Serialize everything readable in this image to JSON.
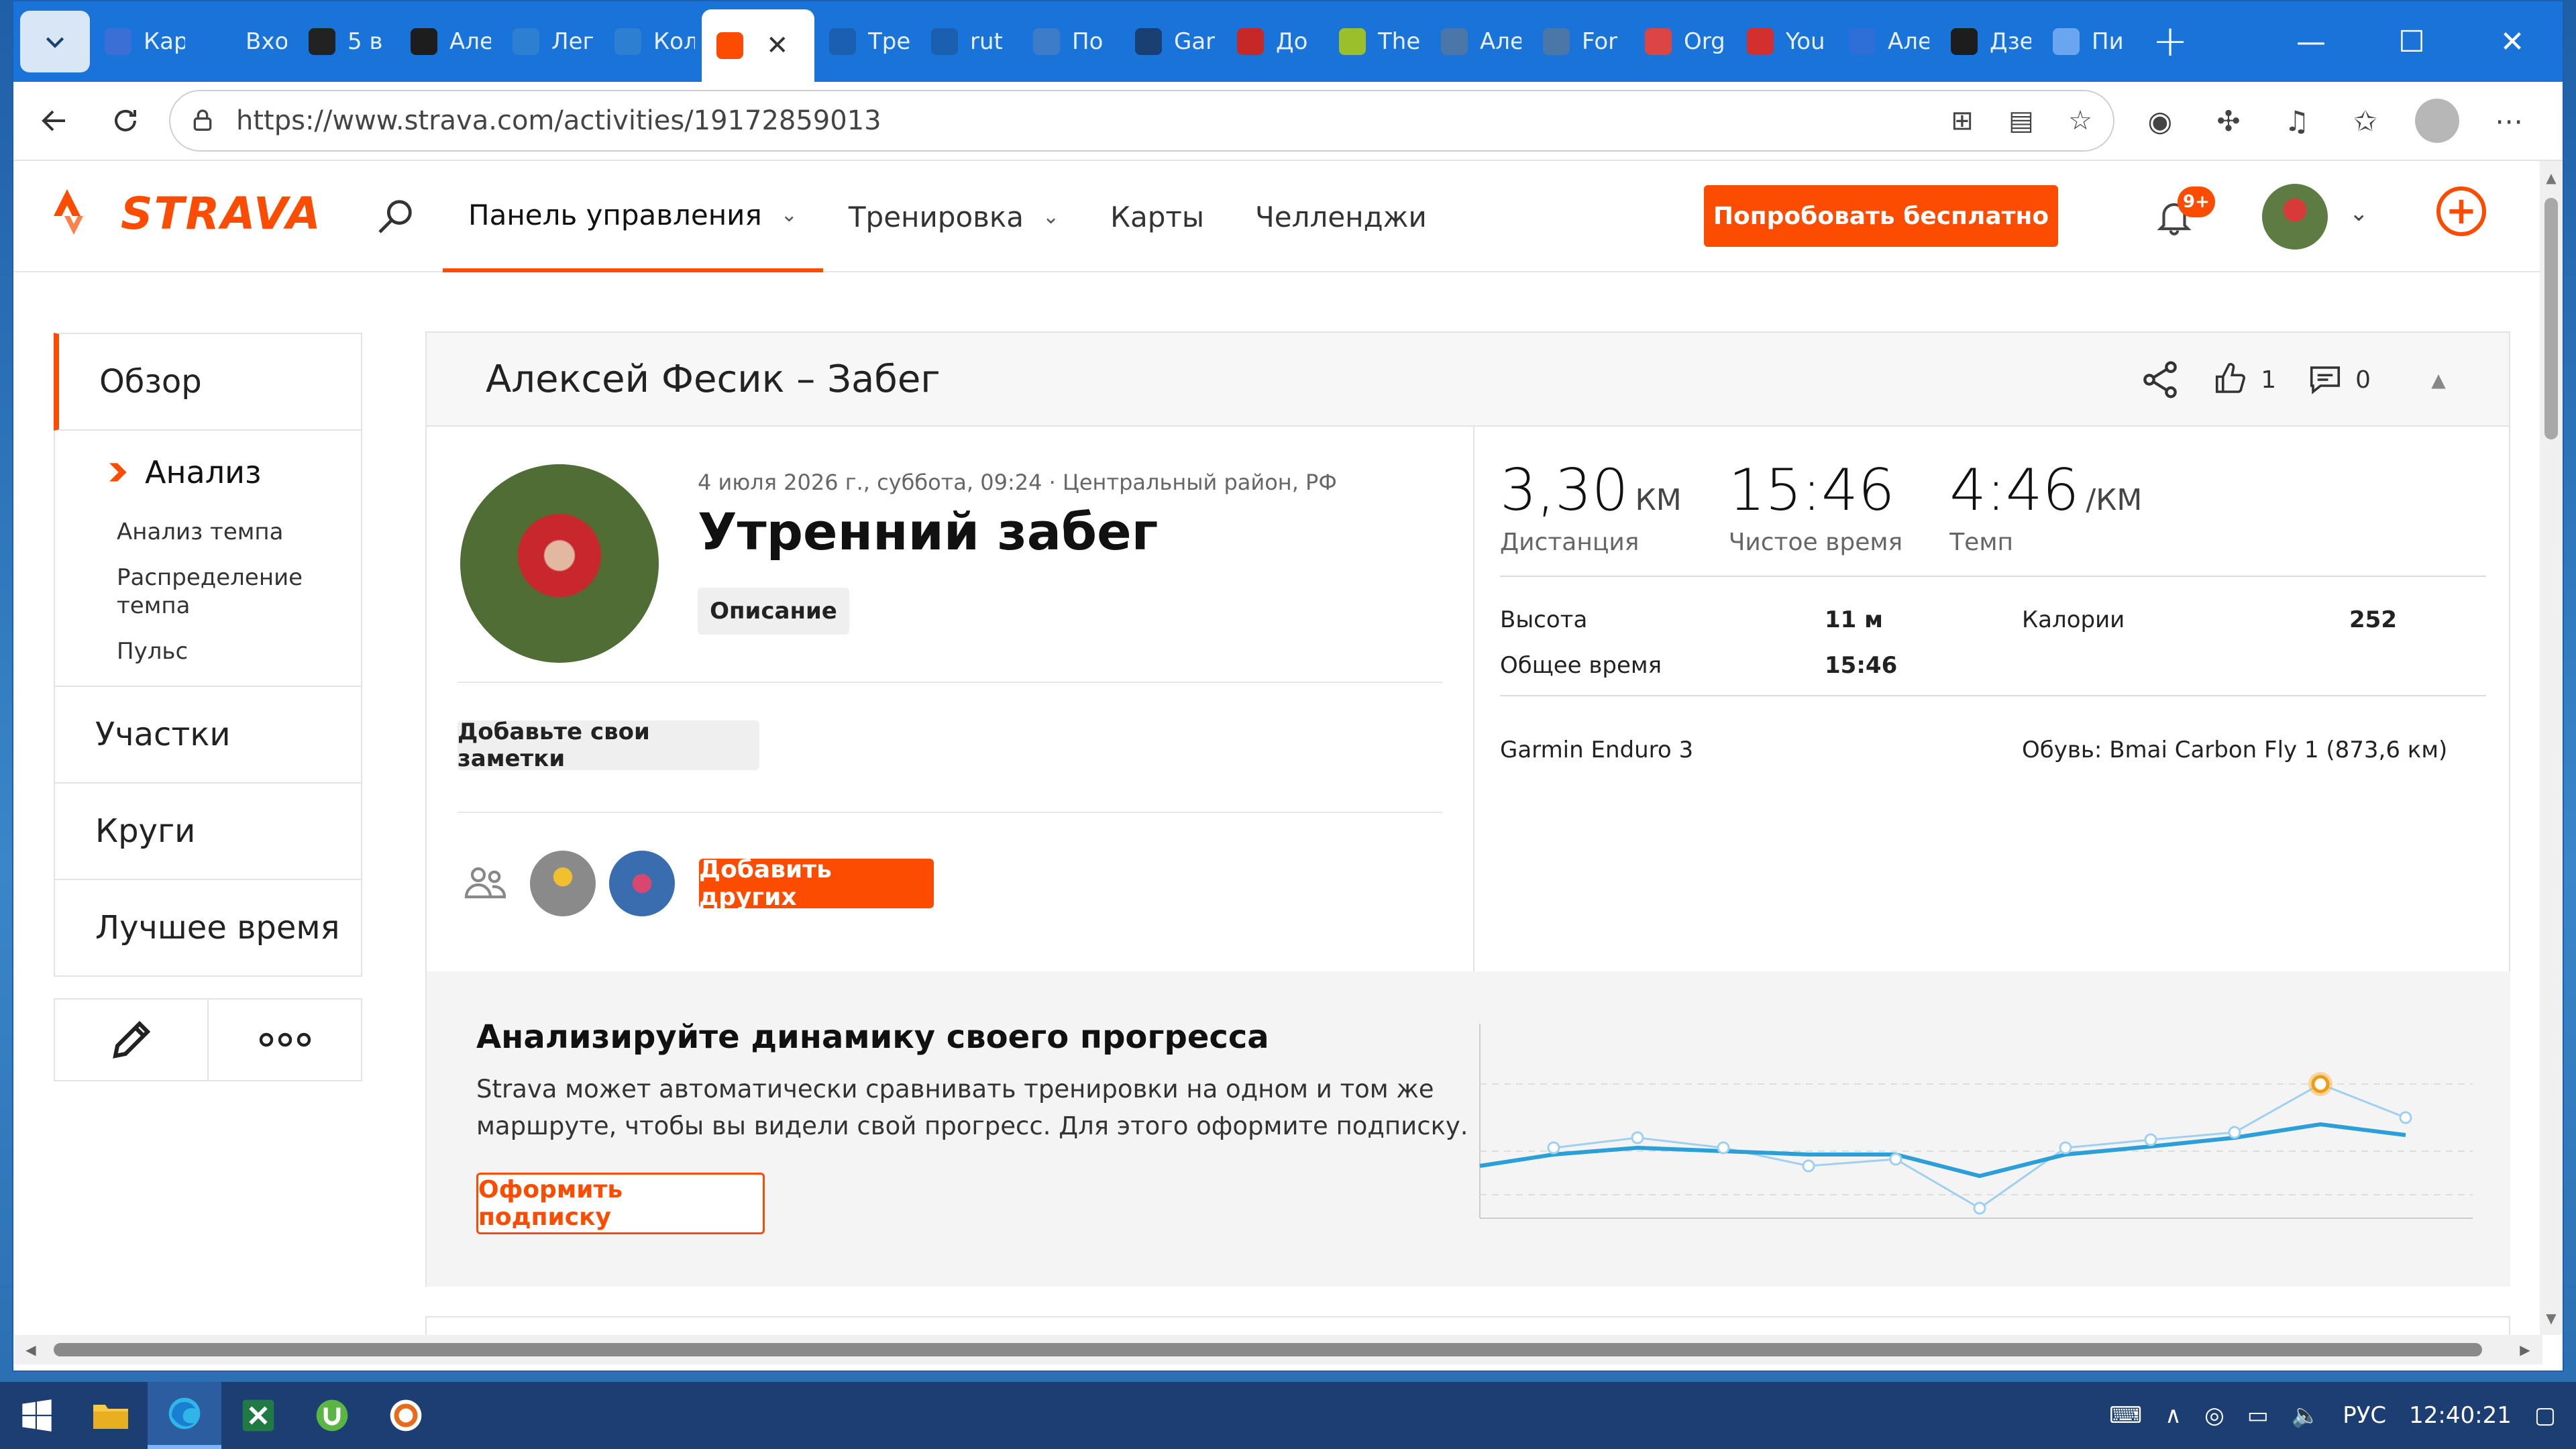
{
  "browser": {
    "tabs": [
      {
        "label": "Кар",
        "icon": "map-pin-icon",
        "color": "#3b6fd6"
      },
      {
        "label": "Вхо",
        "icon": "mail-icon",
        "color": "#1a73d9"
      },
      {
        "label": "5 в",
        "icon": "b-icon",
        "color": "#222222"
      },
      {
        "label": "Але",
        "icon": "runner-icon",
        "color": "#1d1d1d"
      },
      {
        "label": "Лег",
        "icon": "sb-icon",
        "color": "#2d7fd1"
      },
      {
        "label": "Кол",
        "icon": "sb-icon",
        "color": "#2d7fd1"
      },
      {
        "label": "",
        "icon": "strava-icon",
        "color": "#fc4c02",
        "active": true
      },
      {
        "label": "Тре",
        "icon": "drop-icon",
        "color": "#1a5fb0"
      },
      {
        "label": "rut",
        "icon": "lock-icon",
        "color": "#1a5fb0"
      },
      {
        "label": "По",
        "icon": "umbrella-icon",
        "color": "#3d7cc9"
      },
      {
        "label": "Gar",
        "icon": "garmin-icon",
        "color": "#1a3f73"
      },
      {
        "label": "До",
        "icon": "flag-icon",
        "color": "#c62828"
      },
      {
        "label": "The",
        "icon": "circle-icon",
        "color": "#9bbf2a"
      },
      {
        "label": "Але",
        "icon": "vk-icon",
        "color": "#4a76a8"
      },
      {
        "label": "For",
        "icon": "vk-icon",
        "color": "#4a76a8"
      },
      {
        "label": "Org",
        "icon": "check-icon",
        "color": "#d44"
      },
      {
        "label": "You",
        "icon": "youtube-icon",
        "color": "#d32f2f"
      },
      {
        "label": "Але",
        "icon": "r-icon",
        "color": "#2d6fd6"
      },
      {
        "label": "Дзе",
        "icon": "star-icon",
        "color": "#1d1d1d"
      },
      {
        "label": "Пи",
        "icon": "edit-icon",
        "color": "#6aa5ef"
      }
    ],
    "url": "https://www.strava.com/activities/19172859013"
  },
  "header": {
    "logo": "STRAVA",
    "nav": [
      {
        "label": "Панель управления",
        "chevron": true,
        "active": true
      },
      {
        "label": "Тренировка",
        "chevron": true
      },
      {
        "label": "Карты"
      },
      {
        "label": "Челленджи"
      }
    ],
    "try_button": "Попробовать бесплатно",
    "notif_badge": "9+"
  },
  "sidebar": {
    "overview": "Обзор",
    "analysis": "Анализ",
    "sub_items": [
      "Анализ темпа",
      "Распределение темпа",
      "Пульс"
    ],
    "items": [
      "Участки",
      "Круги",
      "Лучшее время"
    ]
  },
  "activity": {
    "header_title": "Алексей Фесик – Забег",
    "kudos": "1",
    "comments": "0",
    "meta": "4 июля 2026 г., суббота, 09:24 · Центральный район, РФ",
    "title": "Утренний забег",
    "description_button": "Описание",
    "notes_button": "Добавьте свои заметки",
    "add_others_button": "Добавить других"
  },
  "stats": {
    "primary": [
      {
        "value": "3,30",
        "unit": "КМ",
        "label": "Дистанция"
      },
      {
        "value": "15:46",
        "unit": "",
        "label": "Чистое время"
      },
      {
        "value": "4:46",
        "unit": "/КМ",
        "label": "Темп"
      }
    ],
    "rows": [
      {
        "k1": "Высота",
        "v1": "11 м",
        "k2": "Калории",
        "v2": "252"
      },
      {
        "k1": "Общее время",
        "v1": "15:46",
        "k2": "",
        "v2": ""
      }
    ],
    "device": "Garmin Enduro 3",
    "shoes": "Обувь: Bmai Carbon Fly 1 (873,6 км)"
  },
  "promo": {
    "title": "Анализируйте динамику своего прогресса",
    "text": "Strava может автоматически сравнивать тренировки на одном и том же маршруте, чтобы вы видели свой прогресс. Для этого оформите подписку.",
    "button": "Оформить подписку"
  },
  "taskbar": {
    "lang": "РУС",
    "time": "12:40:21"
  }
}
